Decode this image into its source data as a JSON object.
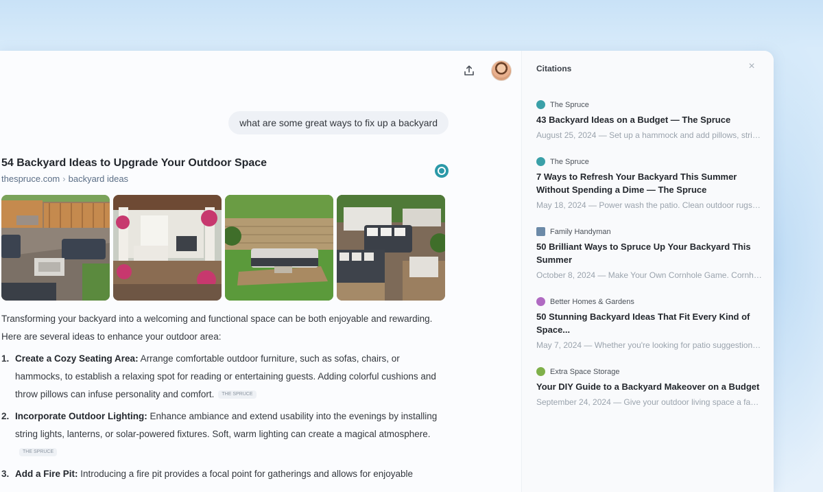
{
  "chat": {
    "user_message": "what are some great ways to fix up a backyard",
    "result": {
      "title": "54 Backyard Ideas to Upgrade Your Outdoor Space",
      "domain": "thespruce.com",
      "path": "backyard ideas",
      "images": [
        "backyard-patio-fence-photo",
        "covered-patio-pergola-photo",
        "backyard-lounge-lawn-photo",
        "pallet-seating-patio-photo"
      ]
    },
    "intro": "Transforming your backyard into a welcoming and functional space can be both enjoyable and rewarding. Here are several ideas to enhance your outdoor area:",
    "list": [
      {
        "num": "1.",
        "title": "Create a Cozy Seating Area:",
        "text": " Arrange comfortable outdoor furniture, such as sofas, chairs, or hammocks, to establish a relaxing spot for reading or entertaining guests. Adding colorful cushions and throw pillows can infuse personality and comfort.",
        "chip": "the spruce"
      },
      {
        "num": "2.",
        "title": "Incorporate Outdoor Lighting:",
        "text": " Enhance ambiance and extend usability into the evenings by installing string lights, lanterns, or solar-powered fixtures. Soft, warm lighting can create a magical atmosphere.",
        "chip": "the spruce"
      },
      {
        "num": "3.",
        "title": "Add a Fire Pit:",
        "text": " Introducing a fire pit provides a focal point for gatherings and allows for enjoyable",
        "chip": ""
      }
    ]
  },
  "citations": {
    "header": "Citations",
    "items": [
      {
        "source": "The Spruce",
        "favicon_color": "#3aa0a8",
        "title": "43 Backyard Ideas on a Budget — The Spruce",
        "snippet": "August 25, 2024 — Set up a hammock and add pillows, string lighting in trees, blankets, and even a place for b..."
      },
      {
        "source": "The Spruce",
        "favicon_color": "#3aa0a8",
        "title": "7 Ways to Refresh Your Backyard This Summer Without Spending a Dime — The Spruce",
        "snippet": "May 18, 2024 — Power wash the patio. Clean outdoor rugs. Wipe down furniture. Wash cushion covers and..."
      },
      {
        "source": "Family Handyman",
        "favicon_color": "#6c8aa8",
        "title": "50 Brilliant Ways to Spruce Up Your Backyard This Summer",
        "snippet": "October 8, 2024 — Make Your Own Cornhole Game. Cornhole boards are a classic backyard game that is a..."
      },
      {
        "source": "Better Homes & Gardens",
        "favicon_color": "#b06ac2",
        "title": "50 Stunning Backyard Ideas That Fit Every Kind of Space...",
        "snippet": "May 7, 2024 — Whether you're looking for patio suggestions, outdoor dining, or a fun space to relax wi..."
      },
      {
        "source": "Extra Space Storage",
        "favicon_color": "#7fb04a",
        "title": "Your DIY Guide to a Backyard Makeover on a Budget",
        "snippet": "September 24, 2024 — Give your outdoor living space a facelift with a calming meditation space. Find a seclud..."
      }
    ]
  }
}
